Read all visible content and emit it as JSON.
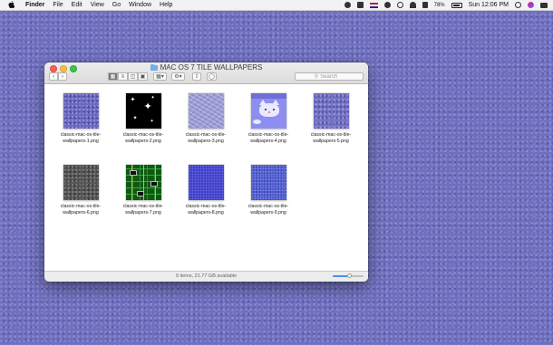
{
  "menubar": {
    "app_name": "Finder",
    "menus": [
      "File",
      "Edit",
      "View",
      "Go",
      "Window",
      "Help"
    ],
    "battery": "78%",
    "clock": "Sun 12:06 PM"
  },
  "window": {
    "title": "MAC OS 7 TILE WALLPAPERS",
    "search_placeholder": "Search",
    "status": "9 items, 21.77 GB available",
    "icon_size_fraction": 0.55
  },
  "files": [
    {
      "line1": "classic-mac-os-tile-",
      "line2": "wallpapers-1.png"
    },
    {
      "line1": "classic-mac-os-tile-",
      "line2": "wallpapers-2.png"
    },
    {
      "line1": "classic-mac-os-tile-",
      "line2": "wallpapers-3.png"
    },
    {
      "line1": "classic-mac-os-tile-",
      "line2": "wallpapers-4.png"
    },
    {
      "line1": "classic-mac-os-tile-",
      "line2": "wallpapers-5.png"
    },
    {
      "line1": "classic-mac-os-tile-",
      "line2": "wallpapers-6.png"
    },
    {
      "line1": "classic-mac-os-tile-",
      "line2": "wallpapers-7.png"
    },
    {
      "line1": "classic-mac-os-tile-",
      "line2": "wallpapers-8.png"
    },
    {
      "line1": "classic-mac-os-tile-",
      "line2": "wallpapers-9.png"
    }
  ],
  "colors": {
    "desktop": "#6f6fc0",
    "close": "#fc605c",
    "minimize": "#fdbc40",
    "zoom": "#34c84a"
  }
}
